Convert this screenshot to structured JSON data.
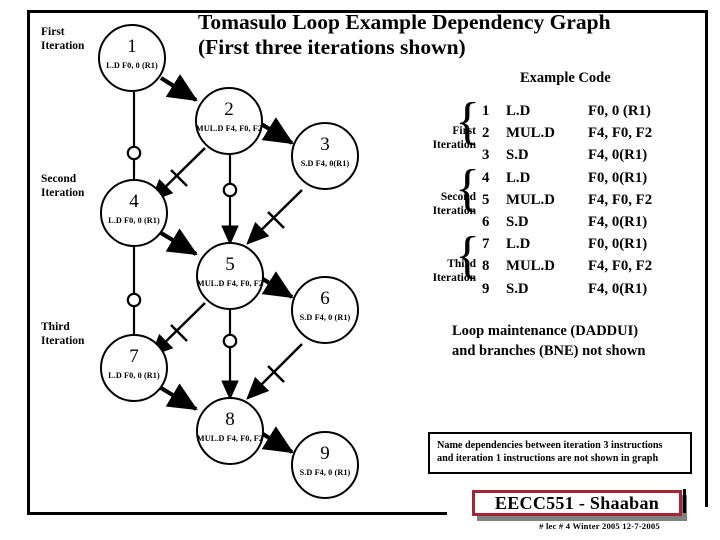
{
  "title": {
    "line1": "Tomasulo Loop Example Dependency Graph",
    "line2": "(First three iterations shown)"
  },
  "graph": {
    "iteration_labels": [
      {
        "line1": "First",
        "line2": "Iteration"
      },
      {
        "line1": "Second",
        "line2": "Iteration"
      },
      {
        "line1": "Third",
        "line2": "Iteration"
      }
    ],
    "nodes": [
      {
        "num": "1",
        "instruction": "L.D  F0, 0 (R1)"
      },
      {
        "num": "2",
        "instruction": "MUL.D  F4, F0, F2"
      },
      {
        "num": "3",
        "instruction": "S.D  F4, 0(R1)"
      },
      {
        "num": "4",
        "instruction": "L.D  F0, 0 (R1)"
      },
      {
        "num": "5",
        "instruction": "MUL.D  F4, F0, F2"
      },
      {
        "num": "6",
        "instruction": "S.D  F4, 0 (R1)"
      },
      {
        "num": "7",
        "instruction": "L.D  F0, 0 (R1)"
      },
      {
        "num": "8",
        "instruction": "MUL.D  F4, F0, F2"
      },
      {
        "num": "9",
        "instruction": "S.D  F4, 0 (R1)"
      }
    ]
  },
  "example_code": {
    "heading": "Example Code",
    "iteration_labels": [
      {
        "line1": "First",
        "line2": "Iteration"
      },
      {
        "line1": "Second",
        "line2": "Iteration"
      },
      {
        "line1": "Third",
        "line2": "Iteration"
      }
    ],
    "brace_glyph": "{",
    "rows": [
      {
        "num": "1",
        "op": "L.D",
        "args": "F0, 0 (R1)"
      },
      {
        "num": "2",
        "op": "MUL.D",
        "args": "F4, F0, F2"
      },
      {
        "num": "3",
        "op": "S.D",
        "args": "F4, 0(R1)"
      },
      {
        "num": "4",
        "op": "L.D",
        "args": "F0,  0(R1)"
      },
      {
        "num": "5",
        "op": "MUL.D",
        "args": "F4, F0, F2"
      },
      {
        "num": "6",
        "op": "S.D",
        "args": "F4, 0(R1)"
      },
      {
        "num": "7",
        "op": "L.D",
        "args": "F0,  0(R1)"
      },
      {
        "num": "8",
        "op": "MUL.D",
        "args": "F4, F0, F2"
      },
      {
        "num": "9",
        "op": "S.D",
        "args": "F4, 0(R1)"
      }
    ]
  },
  "notes": {
    "loop_note_line1": "Loop maintenance (DADDUI)",
    "loop_note_line2": "and branches (BNE) not shown",
    "name_dep_line1": "Name dependencies between iteration 3 instructions",
    "name_dep_line2": "and iteration 1 instructions are not shown in graph"
  },
  "footer": {
    "badge": "EECC551 - Shaaban",
    "small": "#  lec # 4  Winter 2005    12-7-2005",
    "badge_border_color": "#a32638"
  }
}
